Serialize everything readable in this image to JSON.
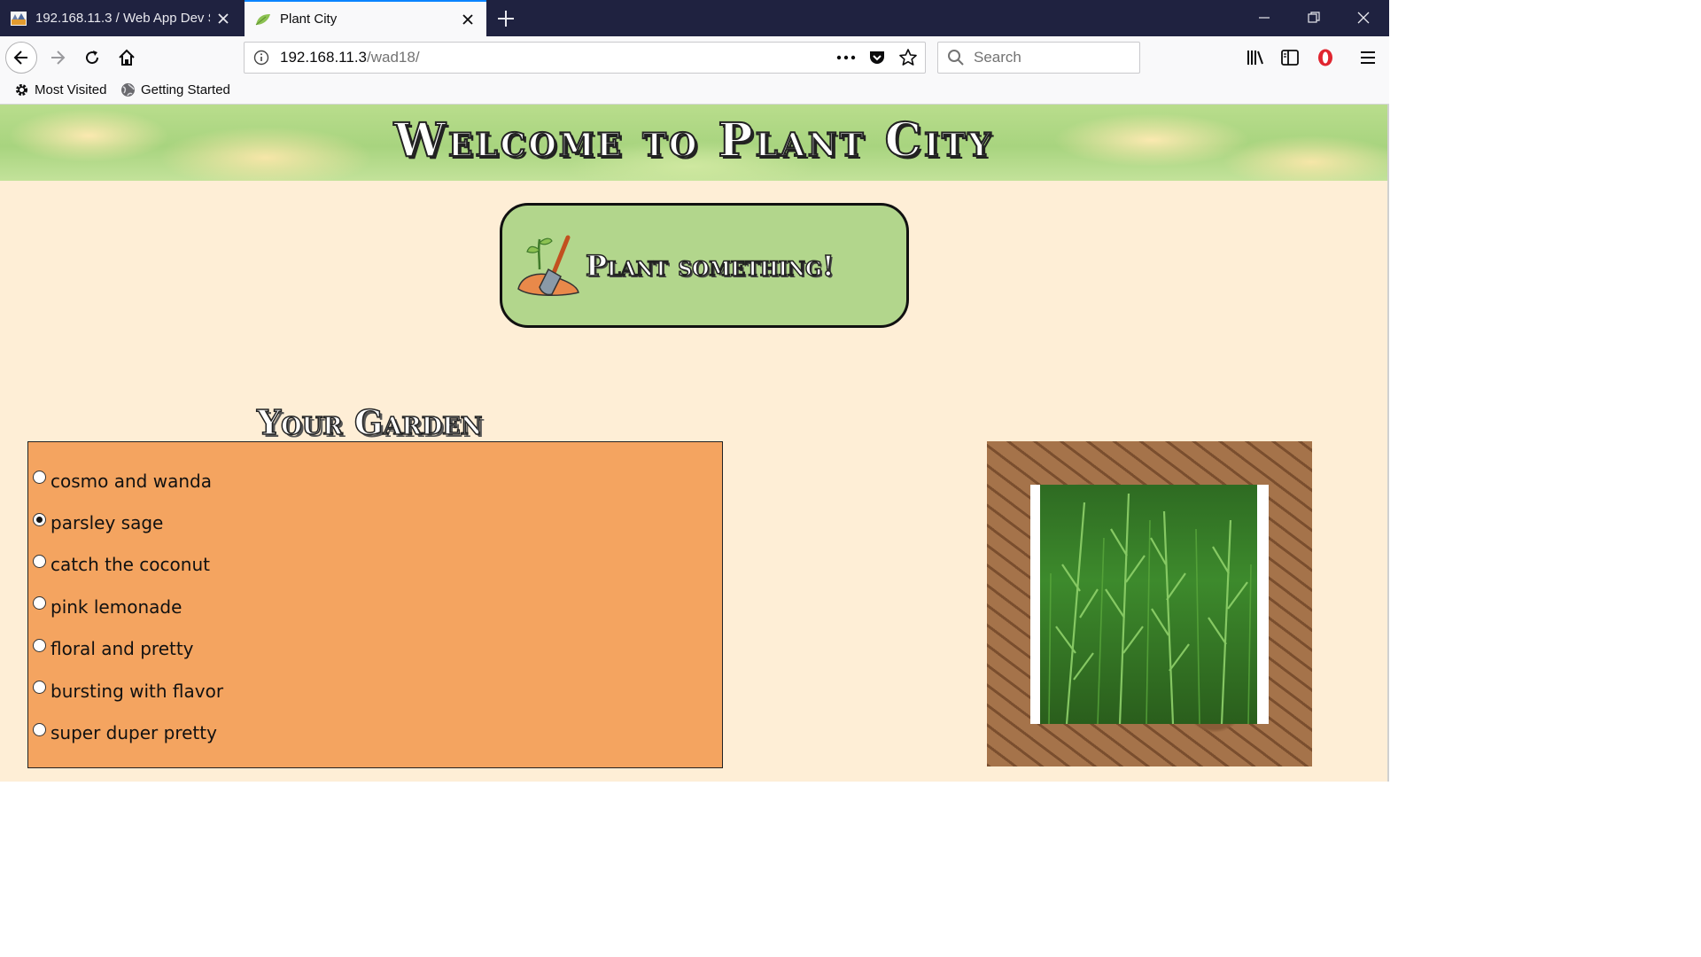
{
  "browser": {
    "tabs": [
      {
        "title": "192.168.11.3 / Web App Dev Se",
        "active": false
      },
      {
        "title": "Plant City",
        "active": true
      }
    ],
    "url": {
      "host": "192.168.11.3",
      "path": "/wad18/"
    },
    "search_placeholder": "Search",
    "bookmarks": [
      {
        "label": "Most Visited",
        "icon": "gear-icon"
      },
      {
        "label": "Getting Started",
        "icon": "globe-icon"
      }
    ]
  },
  "page": {
    "banner_title": "Welcome to Plant City",
    "plant_button_label": "Plant something!",
    "garden_heading": "Your Garden",
    "plants": [
      {
        "name": "cosmo and wanda",
        "selected": false
      },
      {
        "name": "parsley sage",
        "selected": true
      },
      {
        "name": "catch the coconut",
        "selected": false
      },
      {
        "name": "pink lemonade",
        "selected": false
      },
      {
        "name": "floral and pretty",
        "selected": false
      },
      {
        "name": "bursting with flavor",
        "selected": false
      },
      {
        "name": "super duper pretty",
        "selected": false
      }
    ],
    "colors": {
      "page_background": "#feeed6",
      "garden_box": "#f4a460",
      "plant_button": "#b2d68c",
      "banner": "#b9dd8c"
    },
    "photo_subject": "rosemary-plant"
  }
}
